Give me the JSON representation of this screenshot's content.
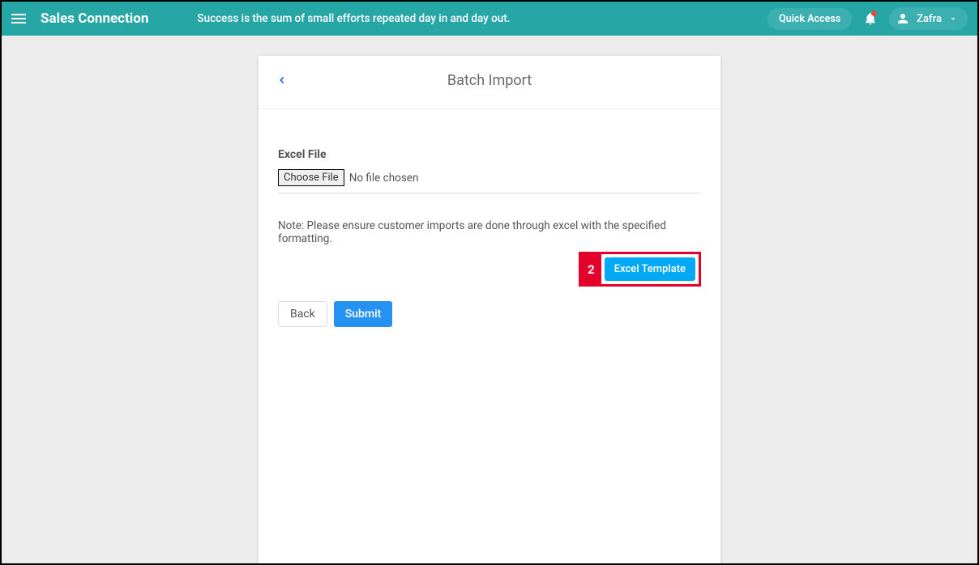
{
  "header": {
    "brand": "Sales Connection",
    "tagline": "Success is the sum of small efforts repeated day in and day out.",
    "quick_access": "Quick Access",
    "user_name": "Zafra"
  },
  "card": {
    "title": "Batch Import",
    "field_label": "Excel File",
    "choose_file": "Choose File",
    "file_status": "No file chosen",
    "note": "Note: Please ensure customer imports are done through excel with the specified formatting.",
    "excel_template": "Excel Template",
    "back": "Back",
    "submit": "Submit"
  },
  "annotation": {
    "number": "2"
  }
}
